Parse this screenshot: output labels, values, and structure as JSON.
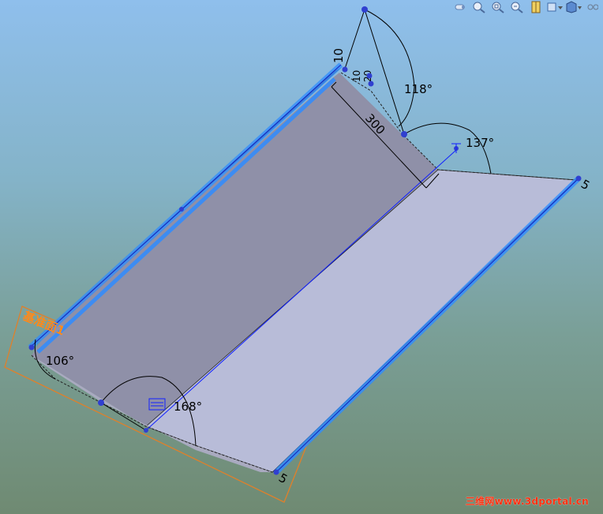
{
  "toolbar": {
    "items": [
      {
        "name": "rotate-view-icon"
      },
      {
        "name": "zoom-to-fit-icon"
      },
      {
        "name": "zoom-to-area-icon"
      },
      {
        "name": "zoom-in-out-icon"
      },
      {
        "name": "section-view-icon"
      },
      {
        "name": "view-orientation-icon"
      },
      {
        "name": "display-style-icon"
      },
      {
        "name": "hide-show-items-icon"
      }
    ]
  },
  "dimensions": {
    "angle_top": "118°",
    "angle_right": "137°",
    "angle_left_bottom": "106°",
    "angle_bottom": "168°",
    "length_main": "300",
    "offset_top_a": "10",
    "offset_top_b": "10",
    "offset_top_c": "20",
    "edge_right": "5",
    "edge_bottom": "5"
  },
  "plane_label": "基准面1",
  "watermark": "三维网www.3dportal.cn",
  "colors": {
    "sketch_blue": "#2f8cff",
    "sketch_dark": "#1020c0",
    "plane_orange": "#e0802a",
    "face_dark": "#8f90a8",
    "face_light": "#b8bcd8",
    "watermark": "#ff3010"
  }
}
